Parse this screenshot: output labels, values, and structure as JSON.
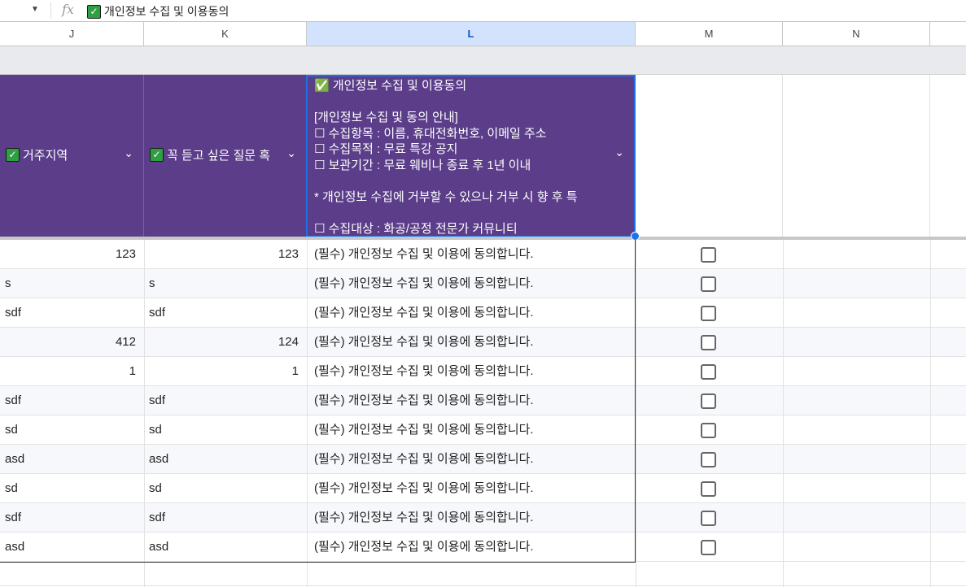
{
  "formula_bar": {
    "fx_label": "fx",
    "value": "개인정보 수집 및 이용동의",
    "check": "✓"
  },
  "columns": [
    "J",
    "K",
    "L",
    "M",
    "N"
  ],
  "header": {
    "J": "거주지역",
    "K": "꼭 듣고 싶은 질문 혹",
    "L": "✅ 개인정보 수집 및 이용동의\n\n[개인정보 수집 및 동의 안내]\n☐ 수집항목 : 이름, 휴대전화번호, 이메일 주소\n☐ 수집목적 : 무료 특강 공지\n☐ 보관기간 : 무료 웨비나 종료 후 1년 이내\n\n* 개인정보 수집에 거부할 수 있으나 거부 시 향 후 특\n\n☐ 수집대상 : 화공/공정 전문가 커뮤니티",
    "chevron": "⌄"
  },
  "rows": [
    {
      "J": "123",
      "K": "123",
      "L": "(필수) 개인정보 수집 및 이용에 동의합니다.",
      "num": true
    },
    {
      "J": "s",
      "K": "s",
      "L": "(필수) 개인정보 수집 및 이용에 동의합니다."
    },
    {
      "J": "sdf",
      "K": "sdf",
      "L": "(필수) 개인정보 수집 및 이용에 동의합니다."
    },
    {
      "J": "412",
      "K": "124",
      "L": "(필수) 개인정보 수집 및 이용에 동의합니다.",
      "num": true
    },
    {
      "J": "1",
      "K": "1",
      "L": "(필수) 개인정보 수집 및 이용에 동의합니다.",
      "num": true
    },
    {
      "J": "sdf",
      "K": "sdf",
      "L": "(필수) 개인정보 수집 및 이용에 동의합니다."
    },
    {
      "J": "sd",
      "K": "sd",
      "L": "(필수) 개인정보 수집 및 이용에 동의합니다."
    },
    {
      "J": "asd",
      "K": "asd",
      "L": "(필수) 개인정보 수집 및 이용에 동의합니다."
    },
    {
      "J": "sd",
      "K": "sd",
      "L": "(필수) 개인정보 수집 및 이용에 동의합니다."
    },
    {
      "J": "sdf",
      "K": "sdf",
      "L": "(필수) 개인정보 수집 및 이용에 동의합니다."
    },
    {
      "J": "asd",
      "K": "asd",
      "L": "(필수) 개인정보 수집 및 이용에 동의합니다."
    }
  ]
}
